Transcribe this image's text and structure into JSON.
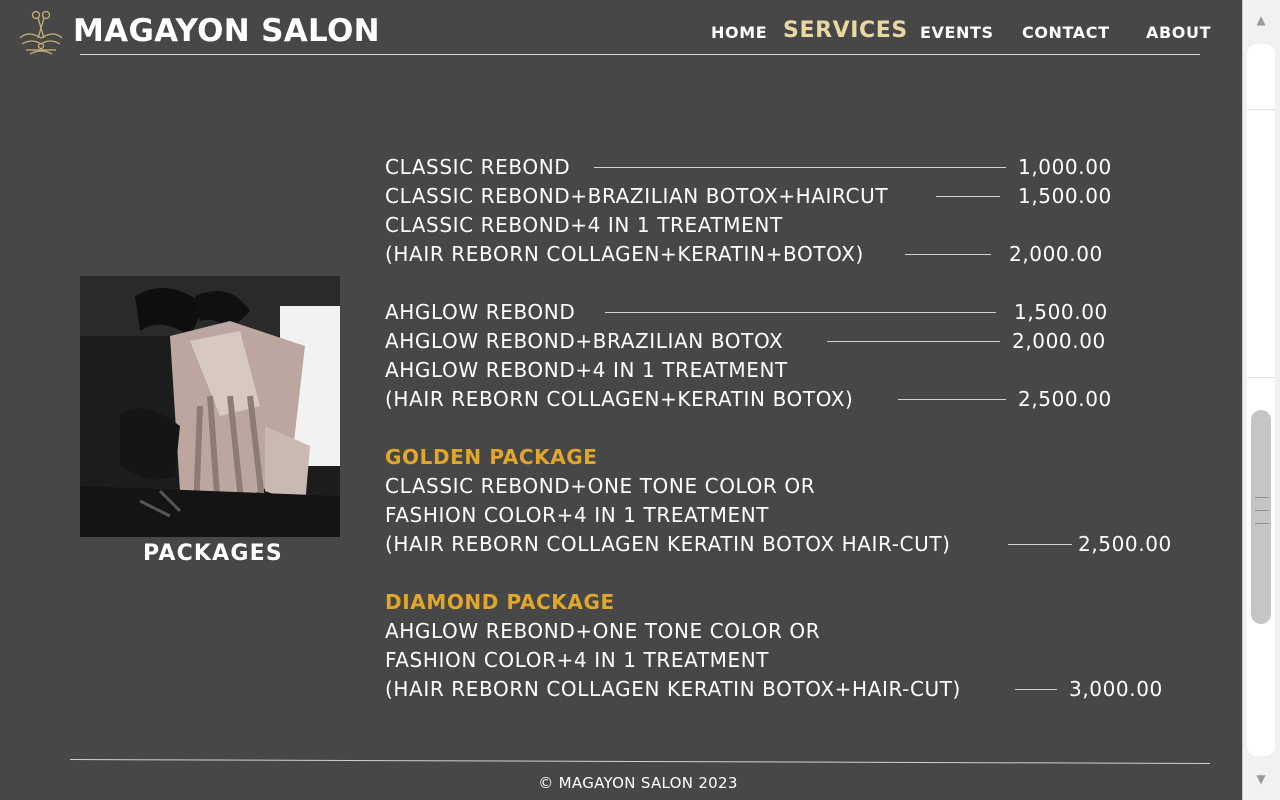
{
  "brand": {
    "name": "MAGAYON SALON",
    "logo_icon": "scissors-crest-icon"
  },
  "nav": {
    "home": "HOME",
    "services": "SERVICES",
    "events": "EVENTS",
    "contact": "CONTACT",
    "about": "ABOUT",
    "active": "SERVICES"
  },
  "sidebar": {
    "caption": "PACKAGES",
    "image": "hair-coloring-foil-photo"
  },
  "prices": {
    "classic_rebond": {
      "label": "CLASSIC REBOND",
      "price": "1,000.00"
    },
    "classic_brazilian": {
      "label": "CLASSIC REBOND+BRAZILIAN BOTOX+HAIRCUT",
      "price": "1,500.00"
    },
    "classic_4in1": {
      "line1": "CLASSIC REBOND+4 IN 1 TREATMENT",
      "line2": "(HAIR REBORN COLLAGEN+KERATIN+BOTOX)",
      "price": "2,000.00"
    },
    "ahglow_rebond": {
      "label": "AHGLOW REBOND",
      "price": "1,500.00"
    },
    "ahglow_brazilian": {
      "label": "AHGLOW REBOND+BRAZILIAN BOTOX",
      "price": "2,000.00"
    },
    "ahglow_4in1": {
      "line1": "AHGLOW REBOND+4 IN 1 TREATMENT",
      "line2": "(HAIR REBORN COLLAGEN+KERATIN BOTOX)",
      "price": "2,500.00"
    },
    "golden": {
      "heading": "GOLDEN PACKAGE",
      "line1": "CLASSIC REBOND+ONE TONE COLOR OR",
      "line2": "FASHION COLOR+4 IN 1 TREATMENT",
      "line3": "(HAIR REBORN COLLAGEN KERATIN BOTOX HAIR-CUT)",
      "price": "2,500.00"
    },
    "diamond": {
      "heading": "DIAMOND PACKAGE",
      "line1": "AHGLOW REBOND+ONE TONE COLOR OR",
      "line2": "FASHION COLOR+4 IN 1 TREATMENT",
      "line3": "(HAIR REBORN COLLAGEN KERATIN BOTOX+HAIR-CUT)",
      "price": "3,000.00"
    }
  },
  "footer": {
    "copyright": "© MAGAYON SALON 2023"
  },
  "colors": {
    "background": "#474747",
    "accent_gold": "#e0a72c",
    "nav_active": "#e9d9a0",
    "text": "#ffffff"
  }
}
